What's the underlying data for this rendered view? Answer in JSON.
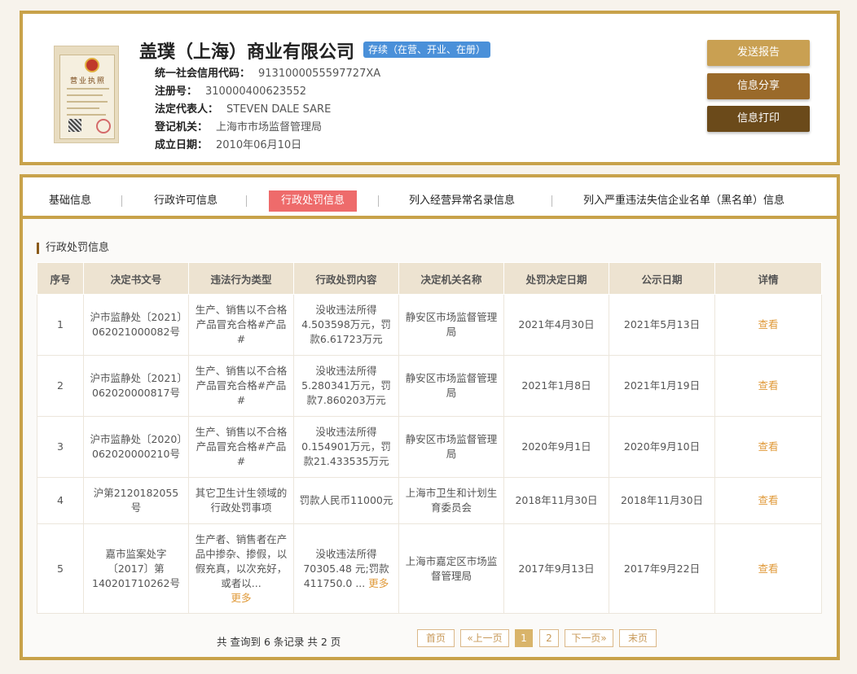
{
  "company": {
    "name": "盖璞（上海）商业有限公司",
    "status": "存续（在营、开业、在册）",
    "license_title": "营业执照",
    "fields": [
      {
        "key": "统一社会信用代码：",
        "value": "9131000055597727XA"
      },
      {
        "key": "注册号：",
        "value": "310000400623552"
      },
      {
        "key": "法定代表人：",
        "value": "STEVEN DALE SARE"
      },
      {
        "key": "登记机关：",
        "value": "上海市市场监督管理局"
      },
      {
        "key": "成立日期：",
        "value": "2010年06月10日"
      }
    ]
  },
  "actions": {
    "send_report": "发送报告",
    "share": "信息分享",
    "print": "信息打印"
  },
  "tabs": [
    "基础信息",
    "行政许可信息",
    "行政处罚信息",
    "列入经营异常名录信息",
    "列入严重违法失信企业名单（黑名单）信息"
  ],
  "section_title": "行政处罚信息",
  "table": {
    "headers": [
      "序号",
      "决定书文号",
      "违法行为类型",
      "行政处罚内容",
      "决定机关名称",
      "处罚决定日期",
      "公示日期",
      "详情"
    ],
    "rows": [
      {
        "no": "1",
        "doc": "沪市监静处〔2021〕062021000082号",
        "type": "生产、销售以不合格产品冒充合格#产品#",
        "content": "没收违法所得4.503598万元，罚款6.61723万元",
        "org": "静安区市场监督管理局",
        "decision_date": "2021年4月30日",
        "publish_date": "2021年5月13日",
        "detail": "查看"
      },
      {
        "no": "2",
        "doc": "沪市监静处〔2021〕062020000817号",
        "type": "生产、销售以不合格产品冒充合格#产品#",
        "content": "没收违法所得5.280341万元，罚款7.860203万元",
        "org": "静安区市场监督管理局",
        "decision_date": "2021年1月8日",
        "publish_date": "2021年1月19日",
        "detail": "查看"
      },
      {
        "no": "3",
        "doc": "沪市监静处〔2020〕062020000210号",
        "type": "生产、销售以不合格产品冒充合格#产品#",
        "content": "没收违法所得0.154901万元，罚款21.433535万元",
        "org": "静安区市场监督管理局",
        "decision_date": "2020年9月1日",
        "publish_date": "2020年9月10日",
        "detail": "查看"
      },
      {
        "no": "4",
        "doc": "沪第2120182055号",
        "type": "其它卫生计生领域的行政处罚事项",
        "content": "罚款人民币11000元",
        "org": "上海市卫生和计划生育委员会",
        "decision_date": "2018年11月30日",
        "publish_date": "2018年11月30日",
        "detail": "查看"
      },
      {
        "no": "5",
        "doc": "嘉市监案处字〔2017〕第140201710262号",
        "type": "生产者、销售者在产品中掺杂、掺假，以假充真，以次充好，或者以...",
        "type_more": "更多",
        "content": "没收违法所得 70305.48 元;罚款 411750.0 ...",
        "content_more": "更多",
        "org": "上海市嘉定区市场监督管理局",
        "decision_date": "2017年9月13日",
        "publish_date": "2017年9月22日",
        "detail": "查看"
      }
    ]
  },
  "pager": {
    "info": "共 查询到 6 条记录 共 2 页",
    "first": "首页",
    "prev": "«上一页",
    "page1": "1",
    "page2": "2",
    "next": "下一页»",
    "last": "末页"
  },
  "colors": {
    "gold": "#c8a24a",
    "active_tab": "#ee6b6b",
    "link": "#e09a3a",
    "badge": "#4a90d9"
  }
}
